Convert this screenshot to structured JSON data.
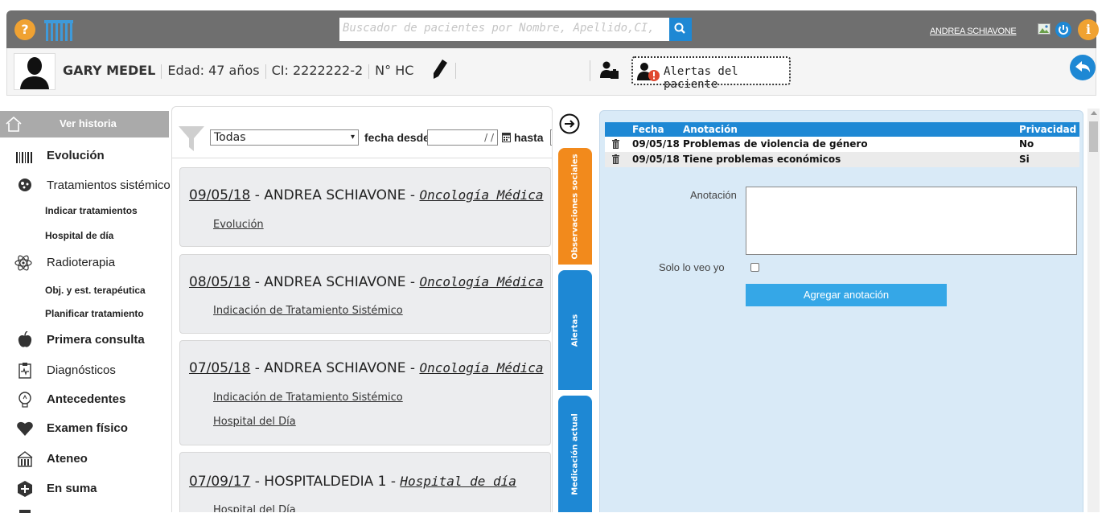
{
  "topbar": {
    "help_label": "?",
    "search_placeholder": "Buscador de pacientes por Nombre, Apellido,CI,",
    "user_name": "ANDREA SCHIAVONE",
    "info_label": "i"
  },
  "patient": {
    "name": "GARY MEDEL",
    "age": "Edad: 47 años",
    "ci": "CI: 2222222-2",
    "hc": "N° HC",
    "alerts_button": "Alertas del paciente"
  },
  "sidebar": {
    "header": "Ver historia",
    "items": [
      {
        "label": "Evolución",
        "bold": true,
        "icon": "barcode-icon"
      },
      {
        "label": "Tratamientos sistémicos",
        "bold": false,
        "icon": "tratamientos-icon"
      },
      {
        "label": "Indicar tratamientos",
        "sub": true
      },
      {
        "label": "Hospital de día",
        "sub": true
      },
      {
        "label": "Radioterapia",
        "bold": false,
        "icon": "atom-icon"
      },
      {
        "label": "Obj. y est. terapéutica",
        "sub": true
      },
      {
        "label": "Planificar tratamiento",
        "sub": true
      },
      {
        "label": "Primera consulta",
        "bold": true,
        "icon": "apple-icon"
      },
      {
        "label": "Diagnósticos",
        "bold": false,
        "icon": "clipboard-icon"
      },
      {
        "label": "Antecedentes",
        "bold": true,
        "icon": "lightbulb-icon"
      },
      {
        "label": "Examen físico",
        "bold": true,
        "icon": "heart-icon"
      },
      {
        "label": "Ateneo",
        "bold": true,
        "icon": "building-icon"
      },
      {
        "label": "En suma",
        "bold": true,
        "icon": "plus-icon"
      }
    ]
  },
  "filter": {
    "select_value": "Todas",
    "desde_label": "fecha desde",
    "desde_value": "/ /",
    "hasta_label": "hasta"
  },
  "history": [
    {
      "date": "09/05/18",
      "author": " - ANDREA SCHIAVONE - ",
      "service": "Oncología Médica",
      "links": [
        "Evolución"
      ]
    },
    {
      "date": "08/05/18",
      "author": " - ANDREA SCHIAVONE - ",
      "service": "Oncología Médica",
      "links": [
        "Indicación de Tratamiento Sistémico"
      ]
    },
    {
      "date": "07/05/18",
      "author": " - ANDREA SCHIAVONE - ",
      "service": "Oncología Médica",
      "links": [
        "Indicación de Tratamiento Sistémico",
        "Hospital del Día"
      ]
    },
    {
      "date": "07/09/17",
      "author": " - HOSPITALDEDIA 1 - ",
      "service": "Hospital de día",
      "links": [
        "Hospital del Día"
      ]
    }
  ],
  "tabs": {
    "social": "Observaciones sociales",
    "alertas": "Alertas",
    "medicacion": "Medicación actual"
  },
  "colors": {
    "social_tab": "#f28a1c",
    "blue_tab": "#1e88d4"
  },
  "annotations": {
    "headers": {
      "fecha": "Fecha",
      "anotacion": "Anotación",
      "privacidad": "Privacidad"
    },
    "rows": [
      {
        "fecha": "09/05/18",
        "anotacion": "Problemas de violencia de género",
        "privacidad": "No"
      },
      {
        "fecha": "09/05/18",
        "anotacion": "Tiene problemas económicos",
        "privacidad": "Si"
      }
    ],
    "anotacion_label": "Anotación",
    "solo_label": "Solo lo veo yo",
    "add_button": "Agregar anotación"
  }
}
